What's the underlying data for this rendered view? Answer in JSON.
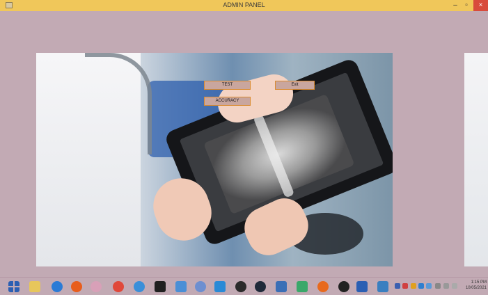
{
  "window": {
    "title": "ADMIN PANEL",
    "minimize_glyph": "–",
    "maximize_glyph": "▫",
    "close_glyph": "×"
  },
  "buttons": {
    "test": "TEST",
    "exit": "Exit",
    "accuracy": "ACCURACY"
  },
  "photo": {
    "icon": "medical-xray-tablet-image"
  },
  "taskbar": {
    "icons": [
      "windows-start-icon",
      "file-explorer-icon",
      "internet-explorer-icon",
      "firefox-icon",
      "app-icon",
      "chrome-icon",
      "app-icon",
      "terminal-icon",
      "app-icon",
      "r-icon",
      "vscode-icon",
      "app-icon",
      "app-icon",
      "app-icon",
      "network-icon",
      "app-icon",
      "app-icon",
      "word-icon",
      "python-icon"
    ],
    "clock_time": "1:15 PM",
    "clock_date": "10/05/2021"
  },
  "colors": {
    "background": "#c2aab4",
    "titlebar": "#f0c75a",
    "button_border": "#d98a2f",
    "close_button": "#d84b3c"
  }
}
